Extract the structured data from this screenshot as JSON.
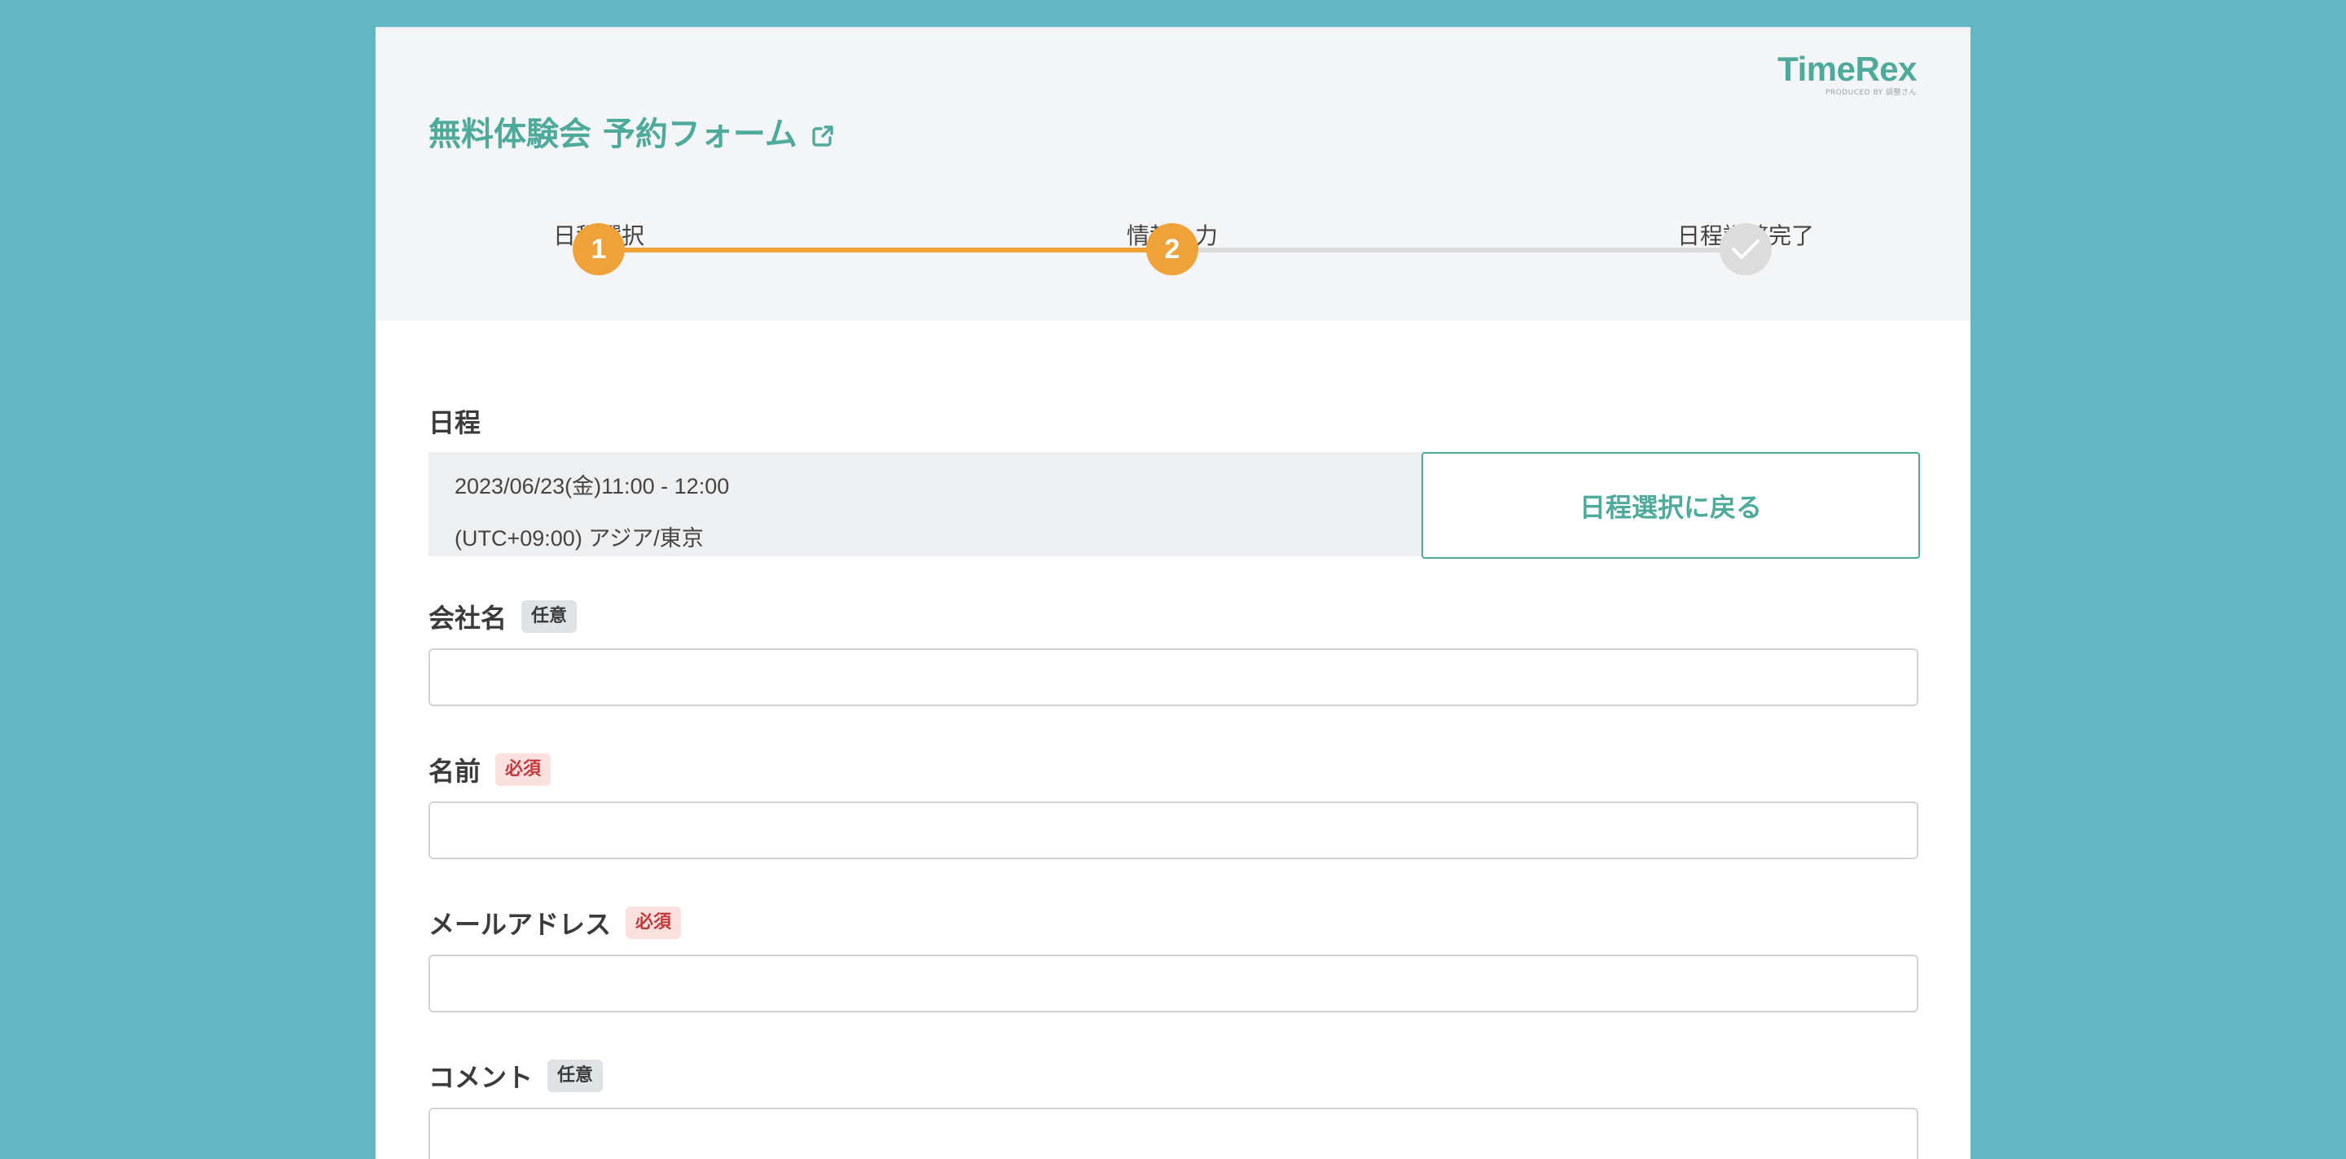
{
  "brand": {
    "logo_text": "TimeRex",
    "logo_sub": "PRODUCED BY 調整さん",
    "accent": "#4eaa9b",
    "step_active": "#f0a23a",
    "step_inactive": "#dcdcdc",
    "background": "#63b7c5"
  },
  "form": {
    "title": "無料体験会 予約フォーム",
    "external_link_icon": "external-link-icon"
  },
  "steps": [
    {
      "label": "日程選択",
      "marker": "1",
      "state": "done"
    },
    {
      "label": "情報入力",
      "marker": "2",
      "state": "current"
    },
    {
      "label": "日程調整完了",
      "marker": "check-icon",
      "state": "pending"
    }
  ],
  "schedule": {
    "label": "日程",
    "datetime": "2023/06/23(金)11:00 - 12:00",
    "timezone": "(UTC+09:00) アジア/東京",
    "back_button": "日程選択に戻る"
  },
  "fields": {
    "company": {
      "label": "会社名",
      "badge": "任意",
      "value": ""
    },
    "name": {
      "label": "名前",
      "badge": "必須",
      "value": ""
    },
    "email": {
      "label": "メールアドレス",
      "badge": "必須",
      "value": ""
    },
    "comment": {
      "label": "コメント",
      "badge": "任意",
      "value": ""
    }
  }
}
